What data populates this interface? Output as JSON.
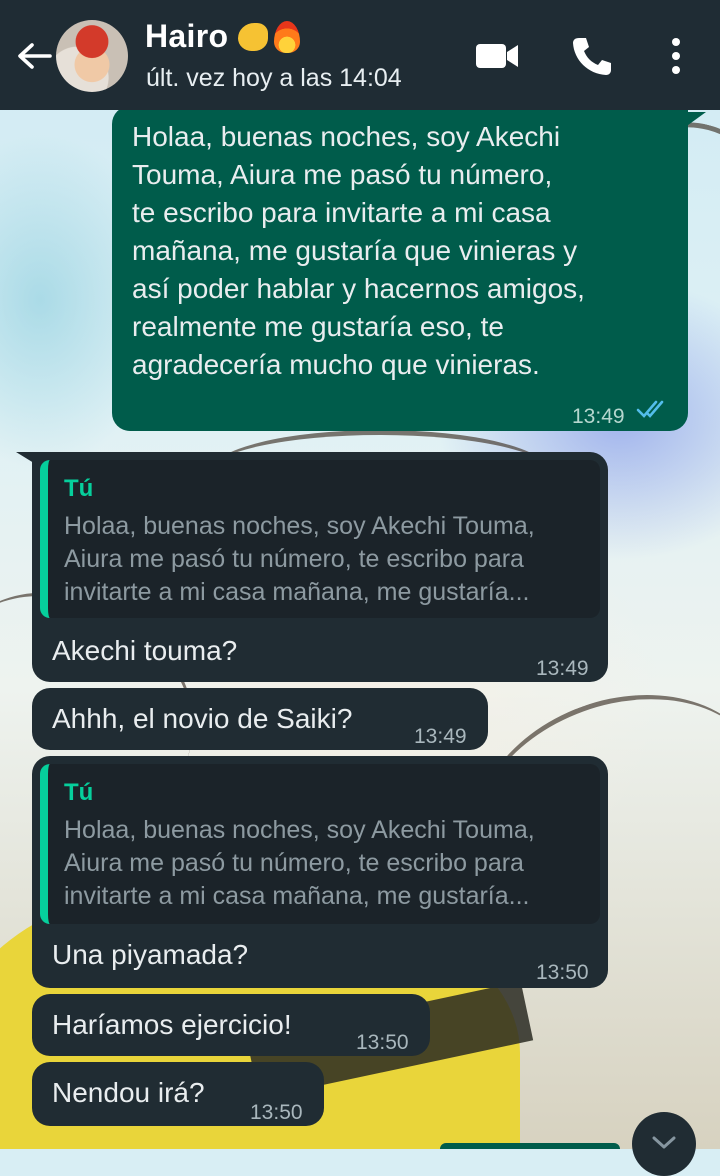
{
  "header": {
    "contact_name": "Hairo",
    "status": "últ. vez hoy a las 14:04"
  },
  "icons": {
    "back": "arrow-left-icon",
    "video": "video-call-icon",
    "call": "phone-icon",
    "more": "more-vertical-icon",
    "read": "double-check-icon",
    "scroll": "chevron-down-icon"
  },
  "colors": {
    "header_bg": "#1f2c34",
    "outgoing_bubble": "#005c4b",
    "incoming_bubble": "#202c33",
    "quote_accent": "#06cf9c",
    "read_ticks": "#53bdeb"
  },
  "messages": [
    {
      "direction": "out",
      "text": "Holaa, buenas noches, soy Akechi\nTouma, Aiura me pasó tu número,\nte escribo para invitarte a mi casa\nmañana, me gustaría que vinieras y\nasí poder hablar y hacernos amigos,\nrealmente me gustaría eso, te\nagradecería mucho que vinieras.",
      "time": "13:49"
    },
    {
      "direction": "in",
      "quote": {
        "author": "Tú",
        "text": "Holaa, buenas noches, soy Akechi Touma,\nAiura me pasó tu número, te escribo para\ninvitarte a mi casa mañana, me gustaría..."
      },
      "text": "Akechi touma?",
      "time": "13:49"
    },
    {
      "direction": "in",
      "text": "Ahhh, el novio de Saiki?",
      "time": "13:49"
    },
    {
      "direction": "in",
      "quote": {
        "author": "Tú",
        "text": "Holaa, buenas noches, soy Akechi Touma,\nAiura me pasó tu número, te escribo para\ninvitarte a mi casa mañana, me gustaría..."
      },
      "text": "Una piyamada?",
      "time": "13:50"
    },
    {
      "direction": "in",
      "text": "Haríamos ejercicio!",
      "time": "13:50"
    },
    {
      "direction": "in",
      "text": "Nendou irá?",
      "time": "13:50"
    }
  ]
}
